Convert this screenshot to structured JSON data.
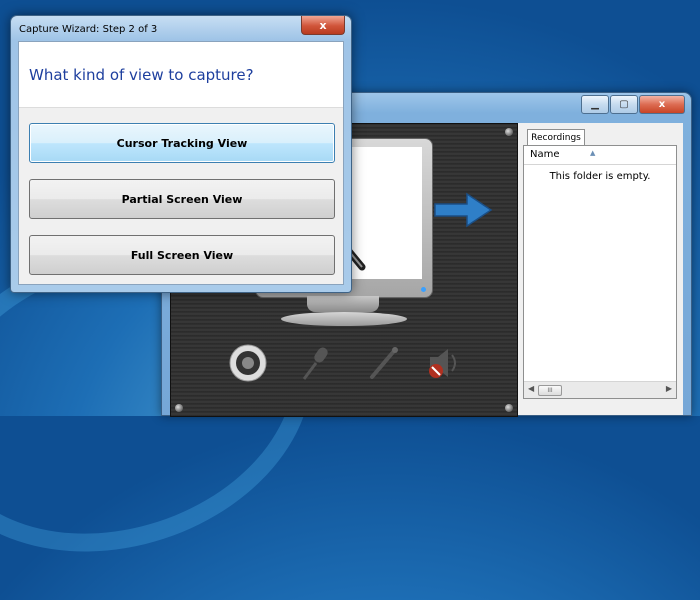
{
  "wizard": {
    "title": "Capture Wizard: Step 2 of 3",
    "close_glyph": "x",
    "heading": "What kind of view to capture?",
    "buttons": [
      {
        "label": "Cursor Tracking View",
        "focused": true
      },
      {
        "label": "Partial Screen View",
        "focused": false
      },
      {
        "label": "Full Screen View",
        "focused": false
      }
    ]
  },
  "main_window": {
    "caption_buttons": [
      "minimize",
      "maximize",
      "close"
    ],
    "close_glyph": "x",
    "preview_icons": [
      "speaker-icon",
      "microphone-icon",
      "line-in-icon",
      "muted-speaker-icon"
    ],
    "recordings": {
      "tab_label": "Recordings",
      "column_header": "Name",
      "empty_text": "This folder is empty.",
      "scroll_thumb": "III"
    }
  },
  "colors": {
    "heading": "#1e3f9e",
    "focused_button": "#bee6fd",
    "close_button": "#d0553a",
    "arrow": "#2f7fc8"
  }
}
